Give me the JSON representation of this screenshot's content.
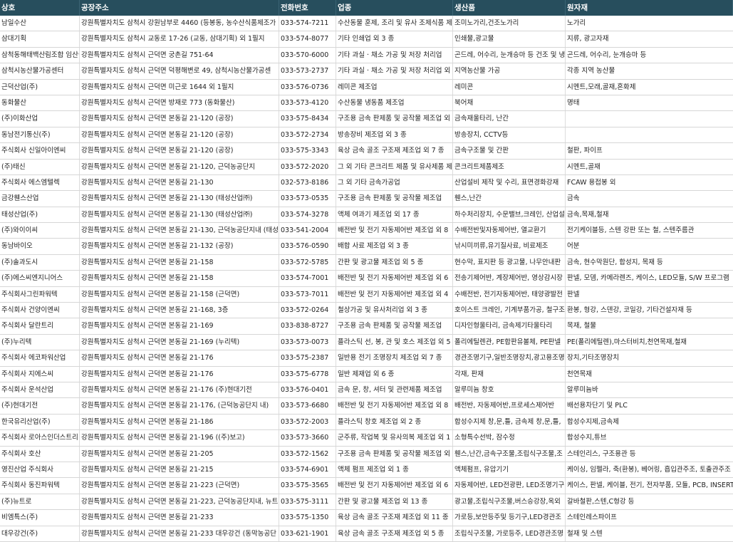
{
  "headers": [
    "상호",
    "공장주소",
    "전화번호",
    "업종",
    "생산품",
    "원자재"
  ],
  "rows": [
    [
      "남일수산",
      "강원특별자치도 삼척시 강원남부로 4460 (등봉동, 농수산식품제조가",
      "033-574-7211",
      "수산동물 훈제, 조리 및 유사 조제식품 제",
      "조미노가리,건조노가리",
      "노가리"
    ],
    [
      "삼대기획",
      "강원특별자치도 삼척시 교동로 17-26 (교동, 삼대기획) 외 1필지",
      "033-574-8077",
      "기타 인쇄업 외 3 종",
      "인쇄물,광고물",
      "지류, 광고자재"
    ],
    [
      "삼척동해태백산림조합 임산물",
      "강원특별자치도 삼척시 근덕면 궁촌길 751-64",
      "033-570-6000",
      "기타 과실 · 채소 가공 및 저장 처리업",
      "곤드레, 어수리, 눈개승마 등 건조 및 냉",
      "곤드레, 어수리, 눈개승마 등"
    ],
    [
      "삼척시농산물가공센터",
      "강원특별자치도 삼척시 근덕면 덕평해변로 49, 삼척시농산물가공센",
      "033-573-2737",
      "기타 과실 · 채소 가공 및 저장 처리업 외",
      "지역농산물 가공",
      "각종 지역 농산물"
    ],
    [
      "근덕산업(주)",
      "강원특별자치도 삼척시 근덕면 미근로 1644 외 1필지",
      "033-576-0736",
      "레미콘 제조업",
      "레미콘",
      "시멘트,모래,골재,혼화제"
    ],
    [
      "동화물산",
      "강원특별자치도 삼척시 근덕면 방재로 773 (동화물산)",
      "033-573-4120",
      "수산동물 냉동품 제조업",
      "북어채",
      "명태"
    ],
    [
      "(주)이화산업",
      "강원특별자치도 삼척시 근덕면 본동길 21-120 (공장)",
      "033-575-8434",
      "구조용 금속 판제품 및 공작물 제조업 외",
      "금속재울타리, 난간",
      ""
    ],
    [
      "동남전기통신(주)",
      "강원특별자치도 삼척시 근덕면 본동길 21-120 (공장)",
      "033-572-2734",
      "방송장비 제조업 외 3 종",
      "방송장치, CCTV등",
      ""
    ],
    [
      "주식회사 신일아이엔씨",
      "강원특별자치도 삼척시 근덕면 본동길 21-120 (공장)",
      "033-575-3343",
      "육상 금속 골조 구조재 제조업 외 7 종",
      "금속구조물 및 간판",
      "철판, 파이프"
    ],
    [
      "(주)태신",
      "강원특별자치도 삼척시 근덕면 본동길 21-120, 근덕농공단지",
      "033-572-2020",
      "그 외 기타 콘크리트 제품 및 유사제품 제",
      "콘크리트제품제조",
      "시멘트,골재"
    ],
    [
      "주식회사 에스엠텔렉",
      "강원특별자치도 삼척시 근덕면 본동길 21-130",
      "032-573-8186",
      "그 외 기타 금속가공업",
      "산업설비 제작 및 수리, 표면경화강재",
      "FCAW 용접봉 외"
    ],
    [
      "금강휀스산업",
      "강원특별자치도 삼척시 근덕면 본동길 21-130 (태성산업㈜)",
      "033-573-0535",
      "구조용 금속 판제품 및 공작물 제조업",
      "휀스,난간",
      "금속"
    ],
    [
      "태성산업(주)",
      "강원특별자치도 삼척시 근덕면 본동길 21-130 (태성산업㈜)",
      "033-574-3278",
      "액체 여과기 제조업 외 17 종",
      "하수처리장치, 수문밸브,크레인, 산업설",
      "금속,목재,철재"
    ],
    [
      "(주)와이이씨",
      "강원특별자치도 삼척시 근덕면 본동길 21-130, 근덕농공단지내 (태성",
      "033-541-2004",
      "배전반 및 전기 자동제어반 제조업 외 8",
      "수배전반및자동제어반, 열교환기",
      "전기케이블등, 스텐 강판 또는 철, 스텐주름관"
    ],
    [
      "동남바이오",
      "강원특별자치도 삼척시 근덕면 본동길 21-132 (공장)",
      "033-576-0590",
      "배합 사료 제조업 외 3 종",
      "낚시미끼류,유기질사료, 비료제조",
      "어분"
    ],
    [
      "(주)솔과도시",
      "강원특별자치도 삼척시 근덕면 본동길 21-158",
      "033-572-5785",
      "간판 및 광고물 제조업 외 5 종",
      "현수막, 표지판 등 광고물, 나무안내판",
      "금속, 현수막원단, 합성지, 목재 등"
    ],
    [
      "(주)에스씨엔지니어스",
      "강원특별자치도 삼척시 근덕면 본동길 21-158",
      "033-574-7001",
      "배전반 및 전기 자동제어반 제조업 외 6",
      "전송기제어반, 계장제어반, 영상감시장",
      "판넬, 모뎀, 카메라렌즈, 케이스, LED모듈, S/W 프로그램"
    ],
    [
      "주식회사그린파워텍",
      "강원특별자치도 삼척시 근덕면 본동길 21-158 (근덕면)",
      "033-573-7011",
      "배전반 및 전기 자동제어반 제조업 외 4",
      "수배전반, 전기자동제어반, 태양광발전",
      "판넬"
    ],
    [
      "주식회사 건양이엔씨",
      "강원특별자치도 삼척시 근덕면 본동길 21-168, 3층",
      "033-572-0264",
      "철상가공 및 유사처리업 외 3 종",
      "호이스트 크레인, 기계부품가공, 철구조",
      "환봉, 형강, 스덴강, 코일강, 기타건설자재 등"
    ],
    [
      "주식회사 달란트리",
      "강원특별자치도 삼척시 근덕면 본동길 21-169",
      "033-838-8727",
      "구조용 금속 판제품 및 공작물 제조업",
      "디자인형울타리, 금속제기타울타리",
      "목재, 철물"
    ],
    [
      "(주)누리텍",
      "강원특별자치도 삼척시 근덕면 본동길 21-169 (누리텍)",
      "033-573-0073",
      "플라스틱 선, 봉, 관 및 호스 제조업 외 5",
      "폴리에틸렌관, PE합판유볼체, PE판넬",
      "PE(폴리에틸렌),마스터비치,천연목재,철재"
    ],
    [
      "주식회사 에코파워산업",
      "강원특별자치도 삼척시 근덕면 본동길 21-176",
      "033-575-2387",
      "일반용 전기 조명장치 제조업 외 7 종",
      "경관조명기구,일반조명장치,광고용조명",
      "장치,기타조명장치"
    ],
    [
      "주식회사 지에스씨",
      "강원특별자치도 삼척시 근덕면 본동길 21-176",
      "033-575-6778",
      "일반 제재업 외 6 종",
      "각재, 판재",
      "천연목재"
    ],
    [
      "주식회사 운석산업",
      "강원특별자치도 삼척시 근덕면 본동길 21-176 (주)현대기전",
      "033-576-0401",
      "금속 문, 창, 셔터 및 관련제품 제조업",
      "알루미늄 창호",
      "알루미늄바"
    ],
    [
      "(주)현대기전",
      "강원특별자치도 삼척시 근덕면 본동길 21-176, (근덕농공단지 내)",
      "033-573-6680",
      "배전반 및 전기 자동제어반 제조업 외 8",
      "배전반, 자동제어반,프로세스제어반",
      "배선용차단기 및 PLC"
    ],
    [
      "한국유리산업(주)",
      "강원특별자치도 삼척시 근덕면 본동길 21-186",
      "033-572-2003",
      "플라스틱 창호 제조업 외 2 종",
      "합성수지제 창,문,틀, 금속제 창,문,틀,",
      "합성수지제,금속제"
    ],
    [
      "주식회사 로아스인더스트리",
      "강원특별자치도 삼척시 근덕면 본동길 21-196 ((주)보고)",
      "033-573-3660",
      "군주류, 작업복 및 유사의복 제조업 외 1",
      "소형특수선박, 잠수정",
      "합성수지,튜브"
    ],
    [
      "주식회사 호산",
      "강원특별자치도 삼척시 근덕면 본동길 21-205",
      "033-572-1562",
      "구조용 금속 판제품 및 공작물 제조업 외",
      "휀스,난간,금속구조물,조립식구조물,조",
      "스테인리스, 구조용관 등"
    ],
    [
      "영진산업 주식회사",
      "강원특별자치도 삼척시 근덕면 본동길 21-215",
      "033-574-6901",
      "액체 펌프 제조업 외 1 종",
      "액체펌프, 유압기기",
      "케이싱, 임펠라, 축(환봉), 베어링, 흡입관주조, 토출관주조"
    ],
    [
      "주식회사 동진파워텍",
      "강원특별자치도 삼척시 근덕면 본동길 21-223 (근덕면)",
      "033-575-3565",
      "배전반 및 전기 자동제어반 제조업 외 6",
      "자동제어반, LED전광판, LED조명기구",
      "케이스, 판넬, 케이블, 전기, 전자부품, 모듈, PCB, INSERT"
    ],
    [
      "(주)뉴트로",
      "강원특별자치도 삼척시 근덕면 본동길 21-223, 근덕농공단지내, 뉴트",
      "033-575-3111",
      "간판 및 광고물 제조업 외 13 종",
      "광고물,조립식구조물,버스승강장,옥외",
      "갈바철판,스텐,C형강 등"
    ],
    [
      "비엠특스(주)",
      "강원특별자치도 삼척시 근덕면 본동길 21-233",
      "033-575-1350",
      "육상 금속 골조 구조재 제조업 외 11 종",
      "가로등,보안등주및 등기구,LED경관조",
      "스테인레스파이프"
    ],
    [
      "대우강건(주)",
      "강원특별자치도 삼척시 근덕면 본동길 21-233 대우강건 (동막농공단",
      "033-621-1901",
      "육상 금속 골조 구조재 제조업 외 5 종",
      "조립식구조물, 가로등주, LED경관조명",
      "철재 및 스텐"
    ]
  ]
}
